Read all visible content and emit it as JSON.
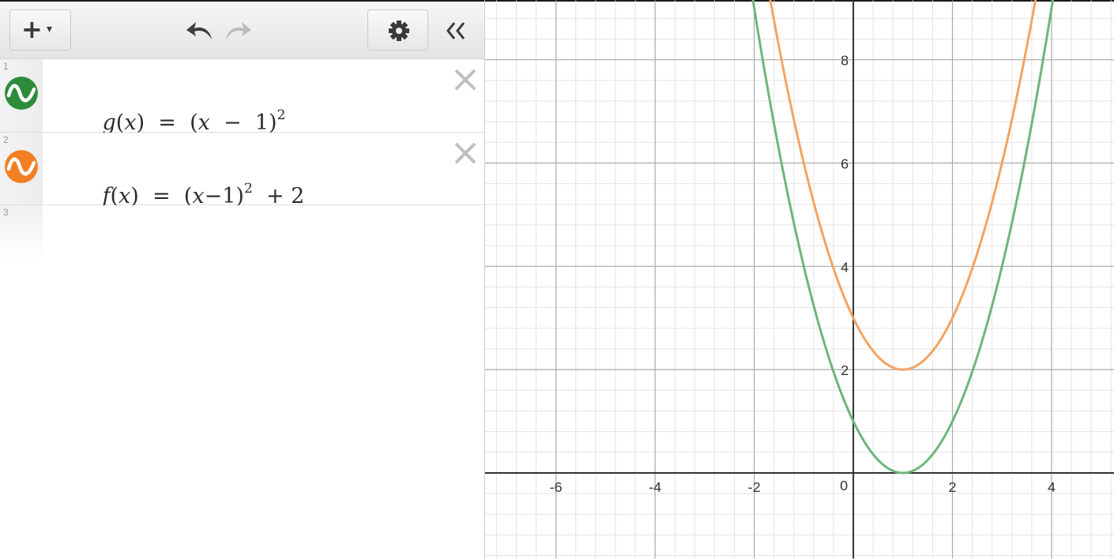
{
  "toolbar": {
    "add_icon": "plus-with-dropdown-icon",
    "undo_icon": "undo-arrow-icon",
    "redo_icon": "redo-arrow-icon",
    "settings_icon": "gear-icon",
    "collapse_icon": "double-chevron-left-icon"
  },
  "expressions": [
    {
      "index": "1",
      "name": "g",
      "var": "x",
      "lhs_open": "(",
      "lhs_close": ")",
      "eq": "=",
      "body": "(",
      "x": "x",
      "minus": "−",
      "one": "1",
      "close": ")",
      "exp": "2",
      "tail": "",
      "color": "#2d8c3c",
      "curve_color": "#6db67a",
      "icon": "wave-icon"
    },
    {
      "index": "2",
      "name": "f",
      "var": "x",
      "lhs_open": "(",
      "lhs_close": ")",
      "eq": "=",
      "body": "(",
      "x": "x",
      "minus": "−",
      "one": "1",
      "close": ")",
      "exp": "2",
      "tail": "+ 2",
      "color": "#f28023",
      "curve_color": "#f2a462",
      "icon": "wave-icon"
    }
  ],
  "empty_row": {
    "index": "3"
  },
  "graph": {
    "x_range": [
      -7.43,
      5.26
    ],
    "y_range": [
      -1.66,
      9.15
    ],
    "x_ticks": [
      "-6",
      "-4",
      "-2",
      "0",
      "2",
      "4"
    ],
    "y_ticks": [
      "8",
      "6",
      "4",
      "2"
    ],
    "origin_label": "0",
    "grid": true,
    "grid_minor_step": 0.4,
    "grid_major_step": 2
  }
}
